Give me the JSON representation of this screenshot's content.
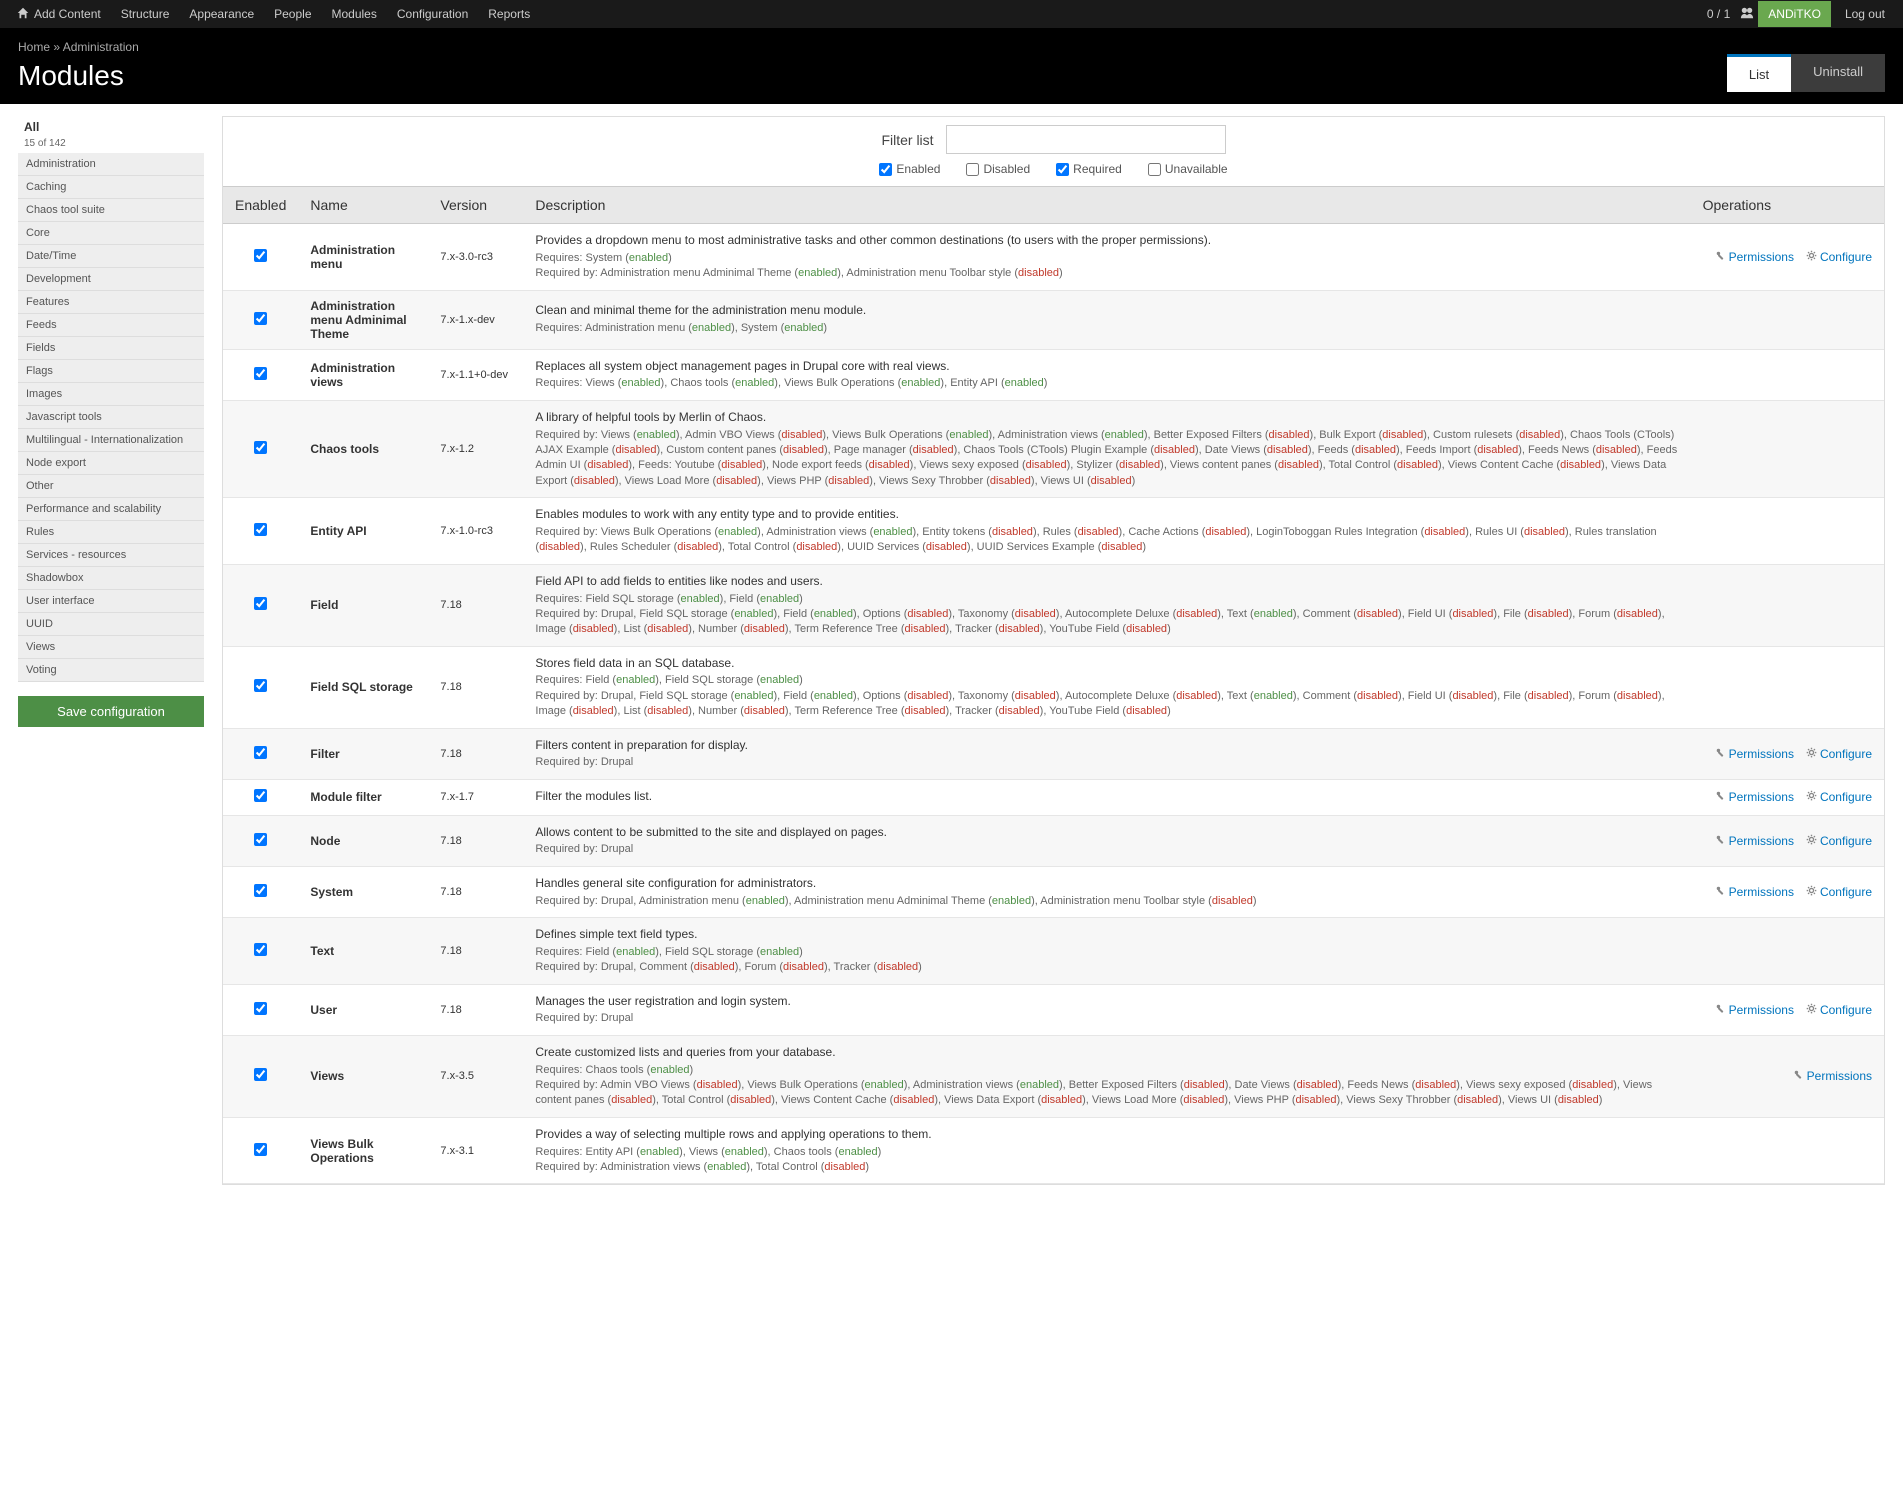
{
  "adminBar": {
    "menu": [
      "Add Content",
      "Structure",
      "Appearance",
      "People",
      "Modules",
      "Configuration",
      "Reports"
    ],
    "userCount": "0 / 1",
    "username": "ANDiTKO",
    "logout": "Log out"
  },
  "breadcrumb": {
    "home": "Home",
    "sep": " » ",
    "admin": "Administration"
  },
  "pageTitle": "Modules",
  "tabs": {
    "list": "List",
    "uninstall": "Uninstall"
  },
  "sidebar": {
    "title": "All",
    "subtitle": "15 of 142",
    "items": [
      "Administration",
      "Caching",
      "Chaos tool suite",
      "Core",
      "Date/Time",
      "Development",
      "Features",
      "Feeds",
      "Fields",
      "Flags",
      "Images",
      "Javascript tools",
      "Multilingual - Internationalization",
      "Node export",
      "Other",
      "Performance and scalability",
      "Rules",
      "Services - resources",
      "Shadowbox",
      "User interface",
      "UUID",
      "Views",
      "Voting"
    ]
  },
  "saveButton": "Save configuration",
  "filter": {
    "label": "Filter list",
    "placeholder": "",
    "checkboxes": [
      {
        "label": "Enabled",
        "checked": true
      },
      {
        "label": "Disabled",
        "checked": false
      },
      {
        "label": "Required",
        "checked": true
      },
      {
        "label": "Unavailable",
        "checked": false
      }
    ]
  },
  "tableHeaders": {
    "enabled": "Enabled",
    "name": "Name",
    "version": "Version",
    "description": "Description",
    "operations": "Operations"
  },
  "opLabels": {
    "permissions": "Permissions",
    "configure": "Configure"
  },
  "modules": [
    {
      "checked": true,
      "name": "Administration menu",
      "version": "7.x-3.0-rc3",
      "desc": "Provides a dropdown menu to most administrative tasks and other common destinations (to users with the proper permissions).",
      "deps": [
        "Requires: System (<e>enabled</e>)",
        "Required by: Administration menu Adminimal Theme (<e>enabled</e>), Administration menu Toolbar style (<d>disabled</d>)"
      ],
      "ops": [
        "permissions",
        "configure"
      ]
    },
    {
      "checked": true,
      "name": "Administration menu Adminimal Theme",
      "version": "7.x-1.x-dev",
      "desc": "Clean and minimal theme for the administration menu module.",
      "deps": [
        "Requires: Administration menu (<e>enabled</e>), System (<e>enabled</e>)"
      ],
      "ops": []
    },
    {
      "checked": true,
      "name": "Administration views",
      "version": "7.x-1.1+0-dev",
      "desc": "Replaces all system object management pages in Drupal core with real views.",
      "deps": [
        "Requires: Views (<e>enabled</e>), Chaos tools (<e>enabled</e>), Views Bulk Operations (<e>enabled</e>), Entity API (<e>enabled</e>)"
      ],
      "ops": []
    },
    {
      "checked": true,
      "name": "Chaos tools",
      "version": "7.x-1.2",
      "desc": "A library of helpful tools by Merlin of Chaos.",
      "deps": [
        "Required by: Views (<e>enabled</e>), Admin VBO Views (<d>disabled</d>), Views Bulk Operations (<e>enabled</e>), Administration views (<e>enabled</e>), Better Exposed Filters (<d>disabled</d>), Bulk Export (<d>disabled</d>), Custom rulesets (<d>disabled</d>), Chaos Tools (CTools) AJAX Example (<d>disabled</d>), Custom content panes (<d>disabled</d>), Page manager (<d>disabled</d>), Chaos Tools (CTools) Plugin Example (<d>disabled</d>), Date Views (<d>disabled</d>), Feeds (<d>disabled</d>), Feeds Import (<d>disabled</d>), Feeds News (<d>disabled</d>), Feeds Admin UI (<d>disabled</d>), Feeds: Youtube (<d>disabled</d>), Node export feeds (<d>disabled</d>), Views sexy exposed (<d>disabled</d>), Stylizer (<d>disabled</d>), Views content panes (<d>disabled</d>), Total Control (<d>disabled</d>), Views Content Cache (<d>disabled</d>), Views Data Export (<d>disabled</d>), Views Load More (<d>disabled</d>), Views PHP (<d>disabled</d>), Views Sexy Throbber (<d>disabled</d>), Views UI (<d>disabled</d>)"
      ],
      "ops": []
    },
    {
      "checked": true,
      "name": "Entity API",
      "version": "7.x-1.0-rc3",
      "desc": "Enables modules to work with any entity type and to provide entities.",
      "deps": [
        "Required by: Views Bulk Operations (<e>enabled</e>), Administration views (<e>enabled</e>), Entity tokens (<d>disabled</d>), Rules (<d>disabled</d>), Cache Actions (<d>disabled</d>), LoginToboggan Rules Integration (<d>disabled</d>), Rules UI (<d>disabled</d>), Rules translation (<d>disabled</d>), Rules Scheduler (<d>disabled</d>), Total Control (<d>disabled</d>), UUID Services (<d>disabled</d>), UUID Services Example (<d>disabled</d>)"
      ],
      "ops": []
    },
    {
      "checked": true,
      "name": "Field",
      "version": "7.18",
      "desc": "Field API to add fields to entities like nodes and users.",
      "deps": [
        "Requires: Field SQL storage (<e>enabled</e>), Field (<e>enabled</e>)",
        "Required by: Drupal, Field SQL storage (<e>enabled</e>), Field (<e>enabled</e>), Options (<d>disabled</d>), Taxonomy (<d>disabled</d>), Autocomplete Deluxe (<d>disabled</d>), Text (<e>enabled</e>), Comment (<d>disabled</d>), Field UI (<d>disabled</d>), File (<d>disabled</d>), Forum (<d>disabled</d>), Image (<d>disabled</d>), List (<d>disabled</d>), Number (<d>disabled</d>), Term Reference Tree (<d>disabled</d>), Tracker (<d>disabled</d>), YouTube Field (<d>disabled</d>)"
      ],
      "ops": []
    },
    {
      "checked": true,
      "name": "Field SQL storage",
      "version": "7.18",
      "desc": "Stores field data in an SQL database.",
      "deps": [
        "Requires: Field (<e>enabled</e>), Field SQL storage (<e>enabled</e>)",
        "Required by: Drupal, Field SQL storage (<e>enabled</e>), Field (<e>enabled</e>), Options (<d>disabled</d>), Taxonomy (<d>disabled</d>), Autocomplete Deluxe (<d>disabled</d>), Text (<e>enabled</e>), Comment (<d>disabled</d>), Field UI (<d>disabled</d>), File (<d>disabled</d>), Forum (<d>disabled</d>), Image (<d>disabled</d>), List (<d>disabled</d>), Number (<d>disabled</d>), Term Reference Tree (<d>disabled</d>), Tracker (<d>disabled</d>), YouTube Field (<d>disabled</d>)"
      ],
      "ops": []
    },
    {
      "checked": true,
      "name": "Filter",
      "version": "7.18",
      "desc": "Filters content in preparation for display.",
      "deps": [
        "Required by: Drupal"
      ],
      "ops": [
        "permissions",
        "configure"
      ]
    },
    {
      "checked": true,
      "name": "Module filter",
      "version": "7.x-1.7",
      "desc": "Filter the modules list.",
      "deps": [],
      "ops": [
        "permissions",
        "configure"
      ]
    },
    {
      "checked": true,
      "name": "Node",
      "version": "7.18",
      "desc": "Allows content to be submitted to the site and displayed on pages.",
      "deps": [
        "Required by: Drupal"
      ],
      "ops": [
        "permissions",
        "configure"
      ]
    },
    {
      "checked": true,
      "name": "System",
      "version": "7.18",
      "desc": "Handles general site configuration for administrators.",
      "deps": [
        "Required by: Drupal, Administration menu (<e>enabled</e>), Administration menu Adminimal Theme (<e>enabled</e>), Administration menu Toolbar style (<d>disabled</d>)"
      ],
      "ops": [
        "permissions",
        "configure"
      ]
    },
    {
      "checked": true,
      "name": "Text",
      "version": "7.18",
      "desc": "Defines simple text field types.",
      "deps": [
        "Requires: Field (<e>enabled</e>), Field SQL storage (<e>enabled</e>)",
        "Required by: Drupal, Comment (<d>disabled</d>), Forum (<d>disabled</d>), Tracker (<d>disabled</d>)"
      ],
      "ops": []
    },
    {
      "checked": true,
      "name": "User",
      "version": "7.18",
      "desc": "Manages the user registration and login system.",
      "deps": [
        "Required by: Drupal"
      ],
      "ops": [
        "permissions",
        "configure"
      ]
    },
    {
      "checked": true,
      "name": "Views",
      "version": "7.x-3.5",
      "desc": "Create customized lists and queries from your database.",
      "deps": [
        "Requires: Chaos tools (<e>enabled</e>)",
        "Required by: Admin VBO Views (<d>disabled</d>), Views Bulk Operations (<e>enabled</e>), Administration views (<e>enabled</e>), Better Exposed Filters (<d>disabled</d>), Date Views (<d>disabled</d>), Feeds News (<d>disabled</d>), Views sexy exposed (<d>disabled</d>), Views content panes (<d>disabled</d>), Total Control (<d>disabled</d>), Views Content Cache (<d>disabled</d>), Views Data Export (<d>disabled</d>), Views Load More (<d>disabled</d>), Views PHP (<d>disabled</d>), Views Sexy Throbber (<d>disabled</d>), Views UI (<d>disabled</d>)"
      ],
      "ops": [
        "permissions"
      ]
    },
    {
      "checked": true,
      "name": "Views Bulk Operations",
      "version": "7.x-3.1",
      "desc": "Provides a way of selecting multiple rows and applying operations to them.",
      "deps": [
        "Requires: Entity API (<e>enabled</e>), Views (<e>enabled</e>), Chaos tools (<e>enabled</e>)",
        "Required by: Administration views (<e>enabled</e>), Total Control (<d>disabled</d>)"
      ],
      "ops": []
    }
  ]
}
